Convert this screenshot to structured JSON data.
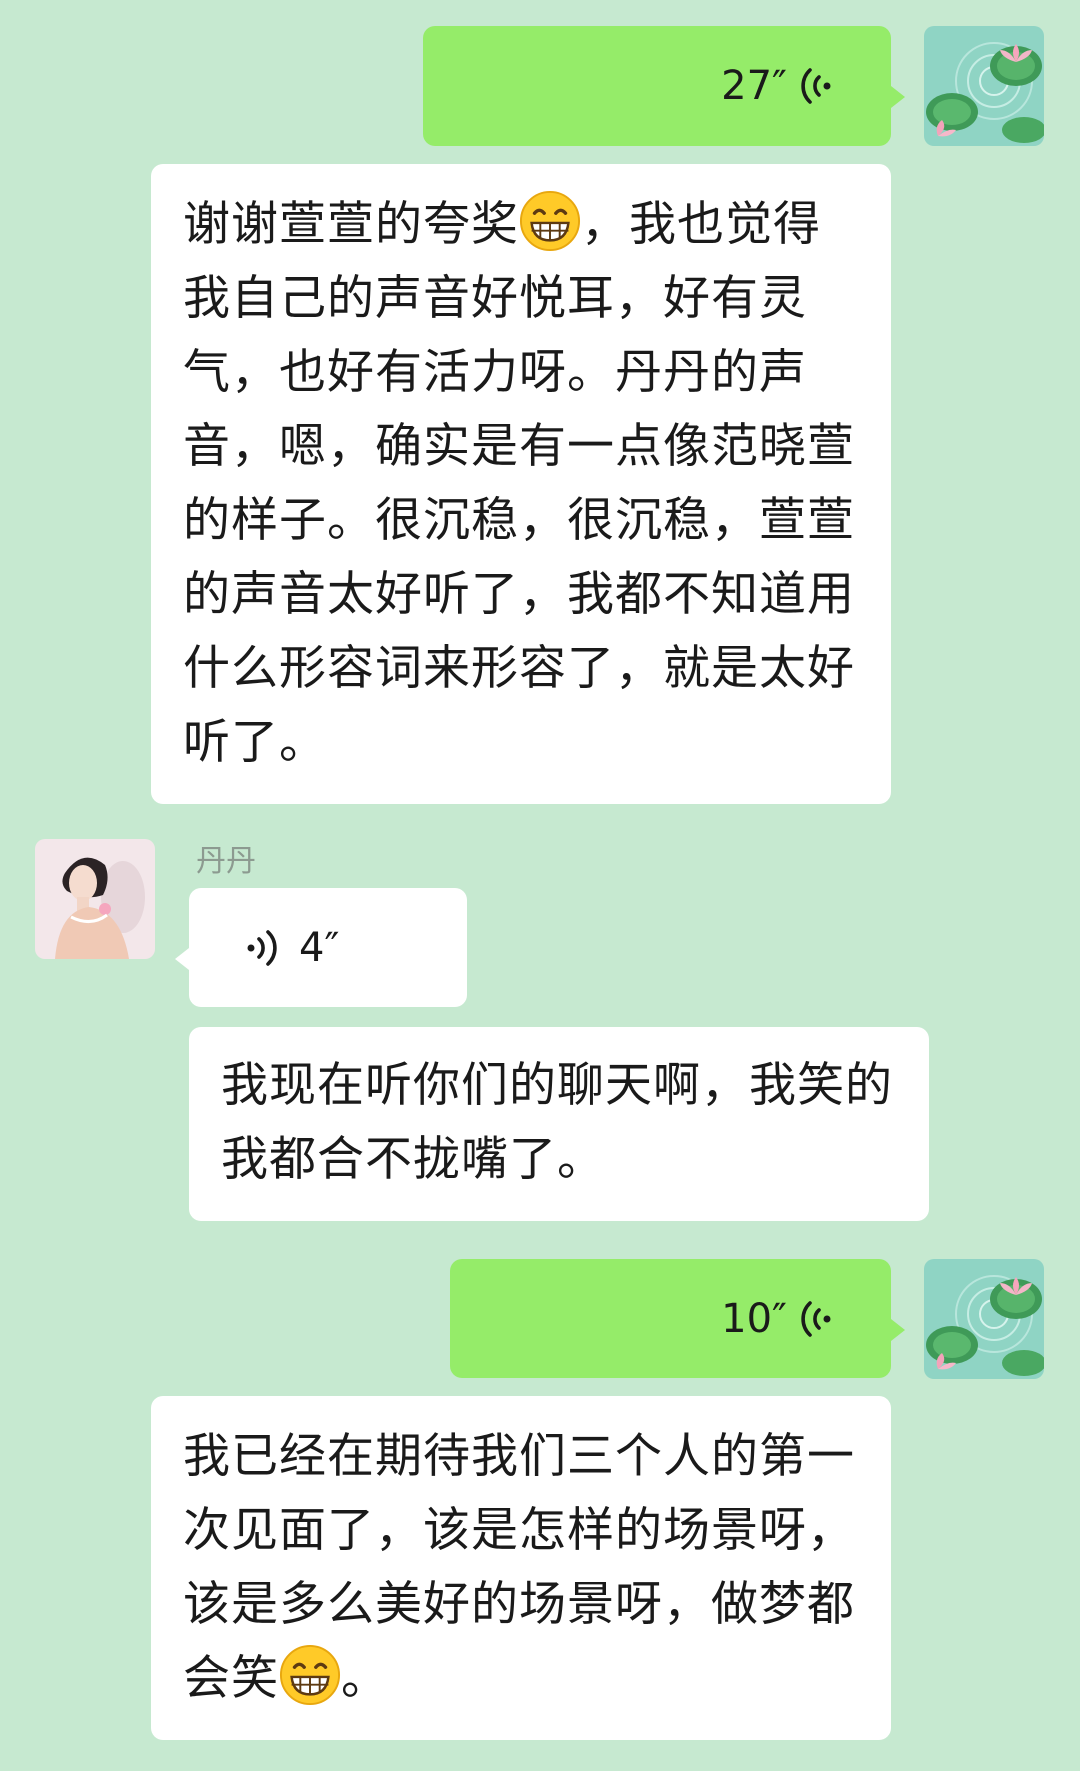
{
  "messages": [
    {
      "id": "m1",
      "side": "right",
      "type": "voice",
      "duration": "27″"
    },
    {
      "id": "m2",
      "side": "right",
      "type": "text",
      "parts": [
        "谢谢萱萱的夸奖",
        "，我也觉得我自己的声音好悦耳，好有灵气，也好有活力呀。丹丹的声音，嗯，确实是有一点像范晓萱的样子。很沉稳，很沉稳，萱萱的声音太好听了，我都不知道用什么形容词来形容了，就是太好听了。"
      ]
    },
    {
      "id": "m3",
      "side": "left",
      "type": "voice",
      "sender": "丹丹",
      "duration": "4″"
    },
    {
      "id": "m4",
      "side": "left",
      "type": "text",
      "text": "我现在听你们的聊天啊，我笑的我都合不拢嘴了。"
    },
    {
      "id": "m5",
      "side": "right",
      "type": "voice",
      "duration": "10″"
    },
    {
      "id": "m6",
      "side": "right",
      "type": "text",
      "parts": [
        "我已经在期待我们三个人的第一次见面了，该是怎样的场景呀，该是多么美好的场景呀，做梦都会笑",
        "。"
      ]
    }
  ],
  "icons": {
    "emoji": "grinning-face-emoji",
    "voice": "voice-wave-icon",
    "my_avatar": "lotus-pond-avatar",
    "other_avatar": "woman-portrait-avatar"
  },
  "colors": {
    "background": "#c6e9d0",
    "my_bubble": "#95ec69",
    "other_bubble": "#ffffff"
  }
}
